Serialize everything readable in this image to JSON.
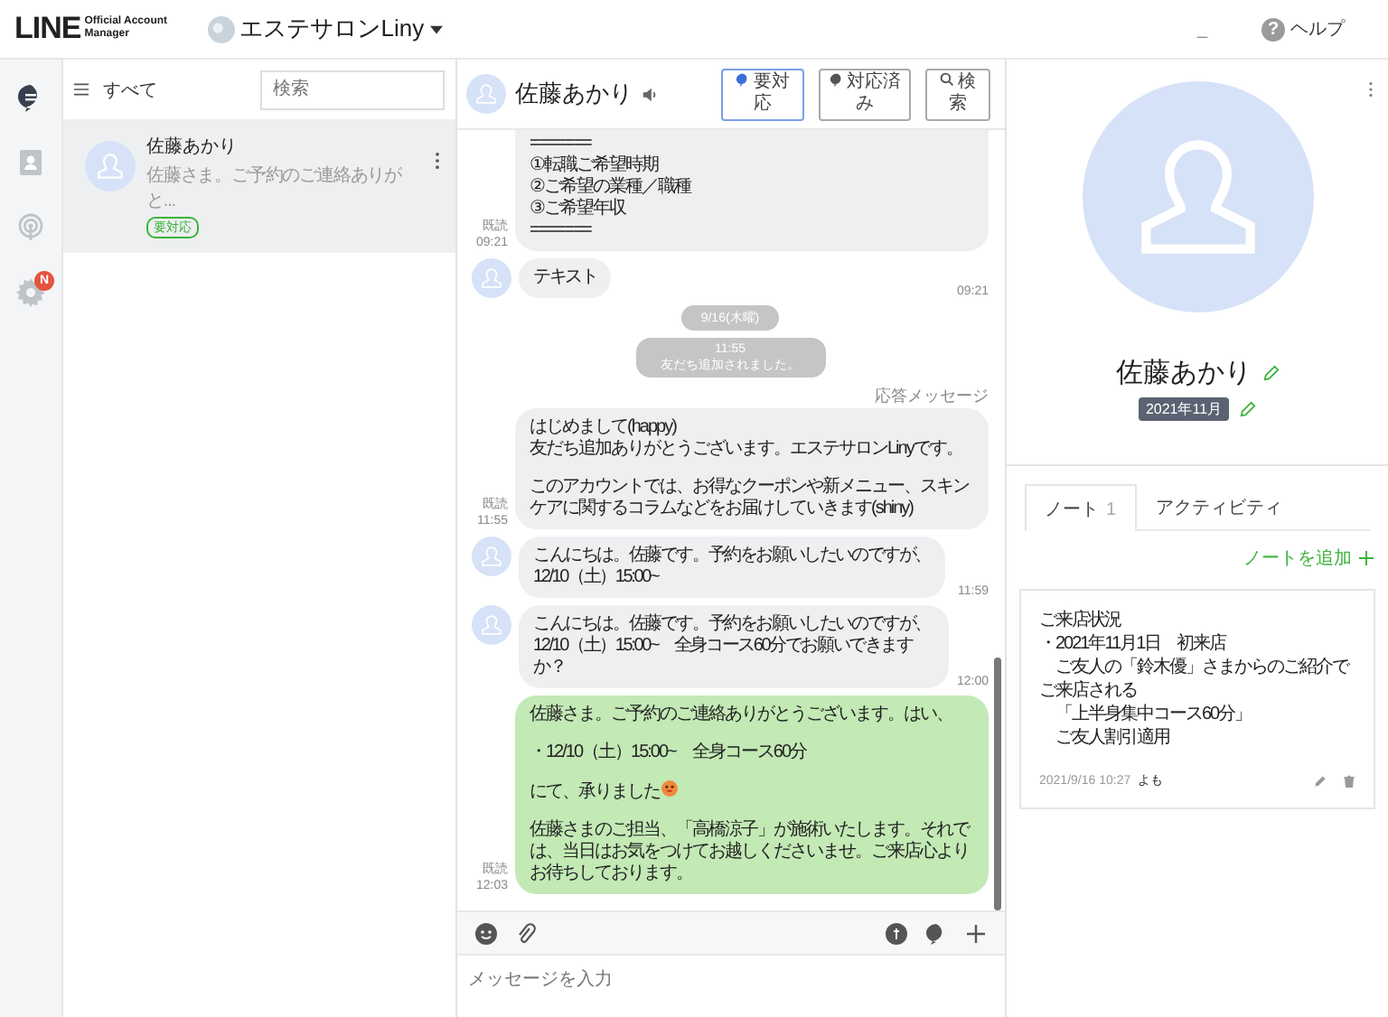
{
  "header": {
    "logo": "LINE",
    "logo_sub": "Official Account Manager",
    "account": "エステサロンLiny",
    "minimize": "_",
    "help_mark": "?",
    "help": "ヘルプ"
  },
  "rail": [
    {
      "kind": "chat",
      "selected": true
    },
    {
      "kind": "contacts",
      "selected": false
    },
    {
      "kind": "broadcast",
      "selected": false
    },
    {
      "kind": "settings",
      "selected": false,
      "badge": "N"
    }
  ],
  "chat_list": {
    "filter": "すべて",
    "search": {
      "placeholder": "検索"
    },
    "items": [
      {
        "name": "佐藤あかり",
        "preview": "佐藤さま。ご予約のご連絡ありがと...",
        "tag": "要対応",
        "selected": true
      }
    ]
  },
  "chat": {
    "title": "佐藤あかり",
    "buttons": [
      {
        "kind": "todo",
        "label": "要対応",
        "selected": true
      },
      {
        "kind": "done",
        "label": "対応済み",
        "selected": false
      },
      {
        "kind": "search",
        "label": "検索",
        "selected": false
      }
    ],
    "messages": [
      {
        "kind": "sent",
        "cut": true,
        "read": "既読",
        "time": "09:21",
        "green": false,
        "paragraphs": [
          {
            "lines": [
              "=======",
              "①転職ご希望時期",
              "②ご希望の業種／職種",
              "③ご希望年収",
              "======="
            ]
          }
        ]
      },
      {
        "kind": "received",
        "time": "09:21",
        "paragraphs": [
          {
            "lines": [
              "テキスト"
            ]
          }
        ]
      },
      {
        "kind": "date",
        "text": "9/16(木曜)"
      },
      {
        "kind": "system",
        "time": "11:55",
        "text": "友だち追加されました。"
      },
      {
        "kind": "label",
        "text": "応答メッセージ"
      },
      {
        "kind": "sent",
        "cut": false,
        "read": "既読",
        "time": "11:55",
        "green": false,
        "paragraphs": [
          {
            "lines": [
              "はじめまして(happy)",
              "友だち追加ありがとうございます。エステサロンLinyです。"
            ]
          },
          {
            "lines": [
              "このアカウントでは、お得なクーポンや新メニュー、スキンケアに関するコラムなどをお届けしていきます(shiny)"
            ]
          }
        ]
      },
      {
        "kind": "received",
        "time": "11:59",
        "paragraphs": [
          {
            "lines": [
              "こんにちは。佐藤です。予約をお願いしたいのですが、",
              "12/10（土）15:00~"
            ]
          }
        ]
      },
      {
        "kind": "received",
        "time": "12:00",
        "paragraphs": [
          {
            "lines": [
              "こんにちは。佐藤です。予約をお願いしたいのですが、",
              "12/10（土）15:00~　全身コース60分でお願いできますか？"
            ]
          }
        ]
      },
      {
        "kind": "sent",
        "cut": false,
        "read": "既読",
        "time": "12:03",
        "green": true,
        "paragraphs": [
          {
            "lines": [
              "佐藤さま。ご予約のご連絡ありがとうございます。はい、"
            ]
          },
          {
            "lines": [
              "・12/10（土）15:00~　全身コース60分"
            ]
          },
          {
            "lines": [
              "にて、承りました"
            ],
            "emoji": true
          },
          {
            "lines": [
              "佐藤さまのご担当、「高橋涼子」が施術いたします。それでは、当日はお気をつけてお越しくださいませ。ご来店心よりお待ちしております。"
            ]
          }
        ]
      }
    ],
    "input": {
      "placeholder": "メッセージを入力"
    }
  },
  "profile": {
    "name": "佐藤あかり",
    "tag": "2021年11月",
    "tabs": [
      {
        "label": "ノート",
        "count": "1",
        "selected": true
      },
      {
        "label": "アクティビティ",
        "selected": false
      }
    ],
    "add_note": "ノートを追加",
    "notes": [
      {
        "lines": [
          "ご来店状況",
          "・2021年11月1日　初来店",
          "　ご友人の「鈴木優」さまからのご紹介でご来店される",
          "　「上半身集中コース60分」",
          "　ご友人割引適用"
        ],
        "date": "2021/9/16 10:27",
        "author": "よも"
      }
    ]
  }
}
